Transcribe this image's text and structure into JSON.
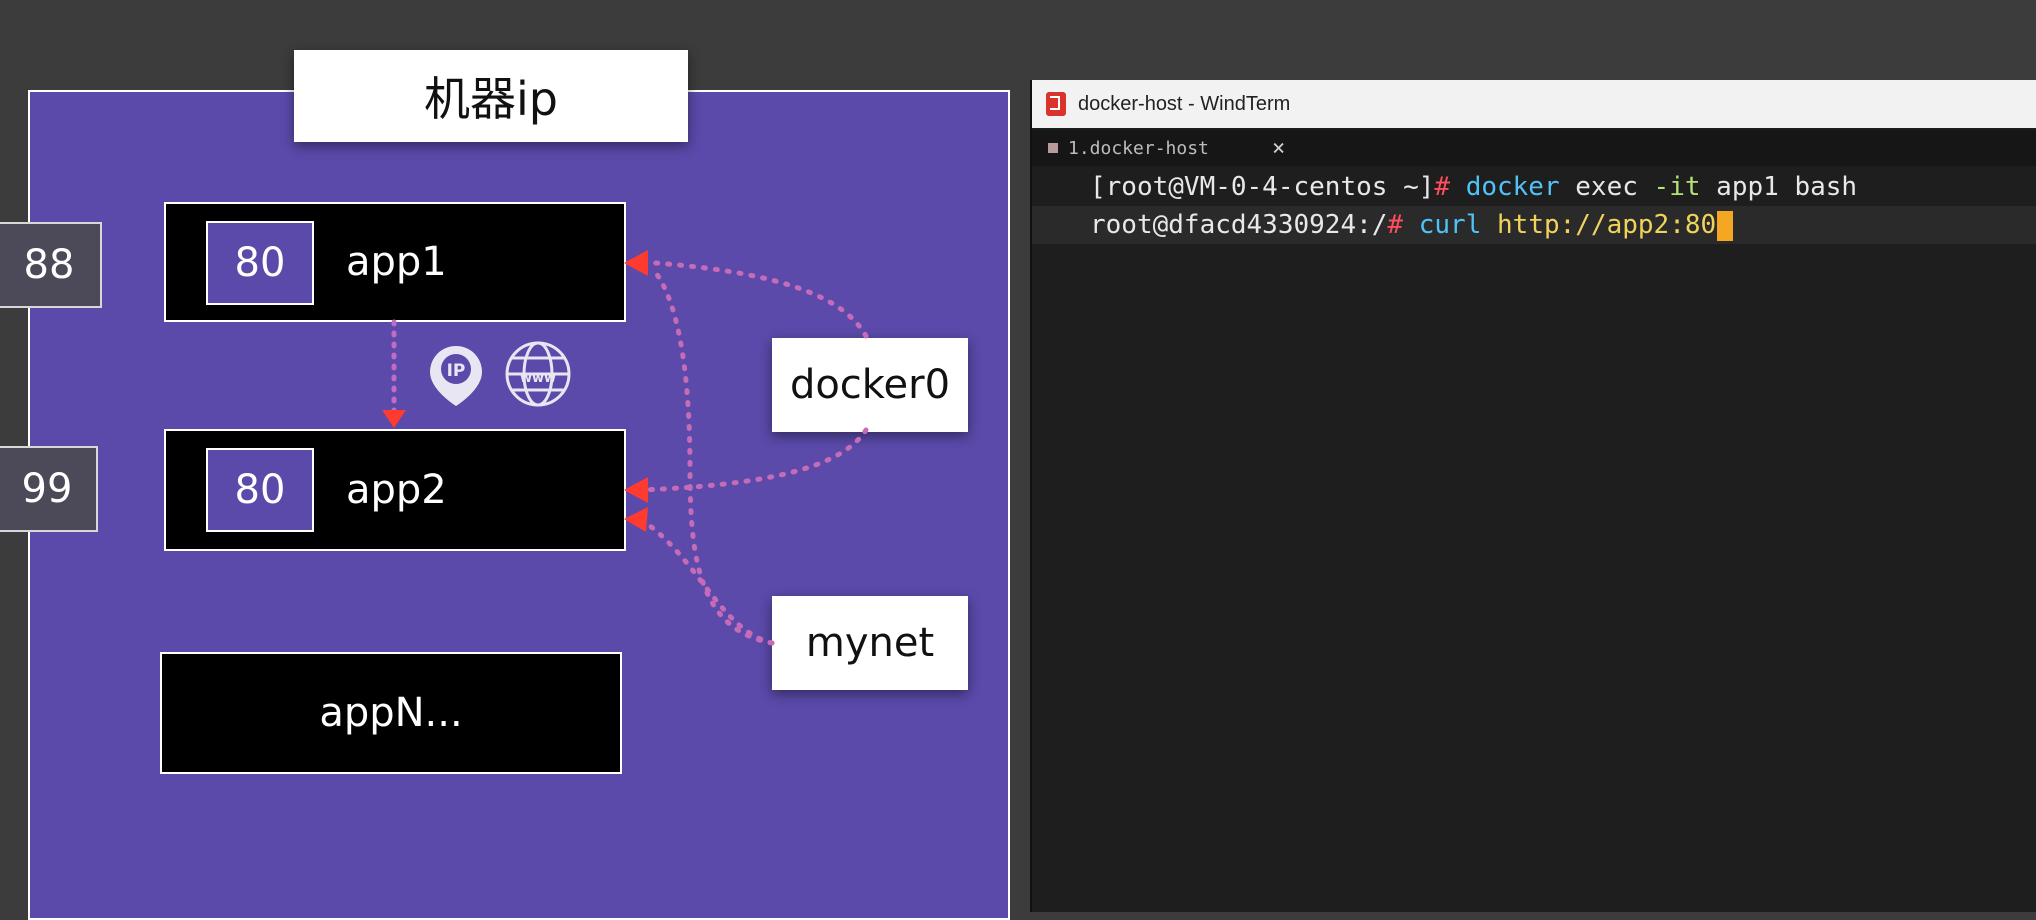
{
  "diagram": {
    "machine_title": "机器ip",
    "host_ports": [
      {
        "label": "88"
      },
      {
        "label": "99"
      }
    ],
    "apps": [
      {
        "port": "80",
        "name": "app1"
      },
      {
        "port": "80",
        "name": "app2"
      }
    ],
    "app_n": "appN...",
    "networks": {
      "docker0": "docker0",
      "mynet": "mynet"
    },
    "icons": {
      "ip_pin": "IP",
      "www": "www"
    },
    "colors": {
      "background": "#5b4aaa",
      "arrow_red": "#ff3b30",
      "link_purple": "#a98fe0"
    }
  },
  "terminal": {
    "window_title": "docker-host - WindTerm",
    "tab_label": "1.docker-host",
    "tab_close": "×",
    "line1": {
      "prompt": "[root@VM-0-4-centos ~]",
      "hash": "#",
      "cmd": "docker",
      "arg1": "exec",
      "flag": "-it",
      "arg2": "app1 bash"
    },
    "line2": {
      "prompt": "root@dfacd4330924:/",
      "hash": "#",
      "cmd": "curl",
      "url": "http://app2:80"
    },
    "colors": {
      "cursor": "#f5a623"
    }
  }
}
